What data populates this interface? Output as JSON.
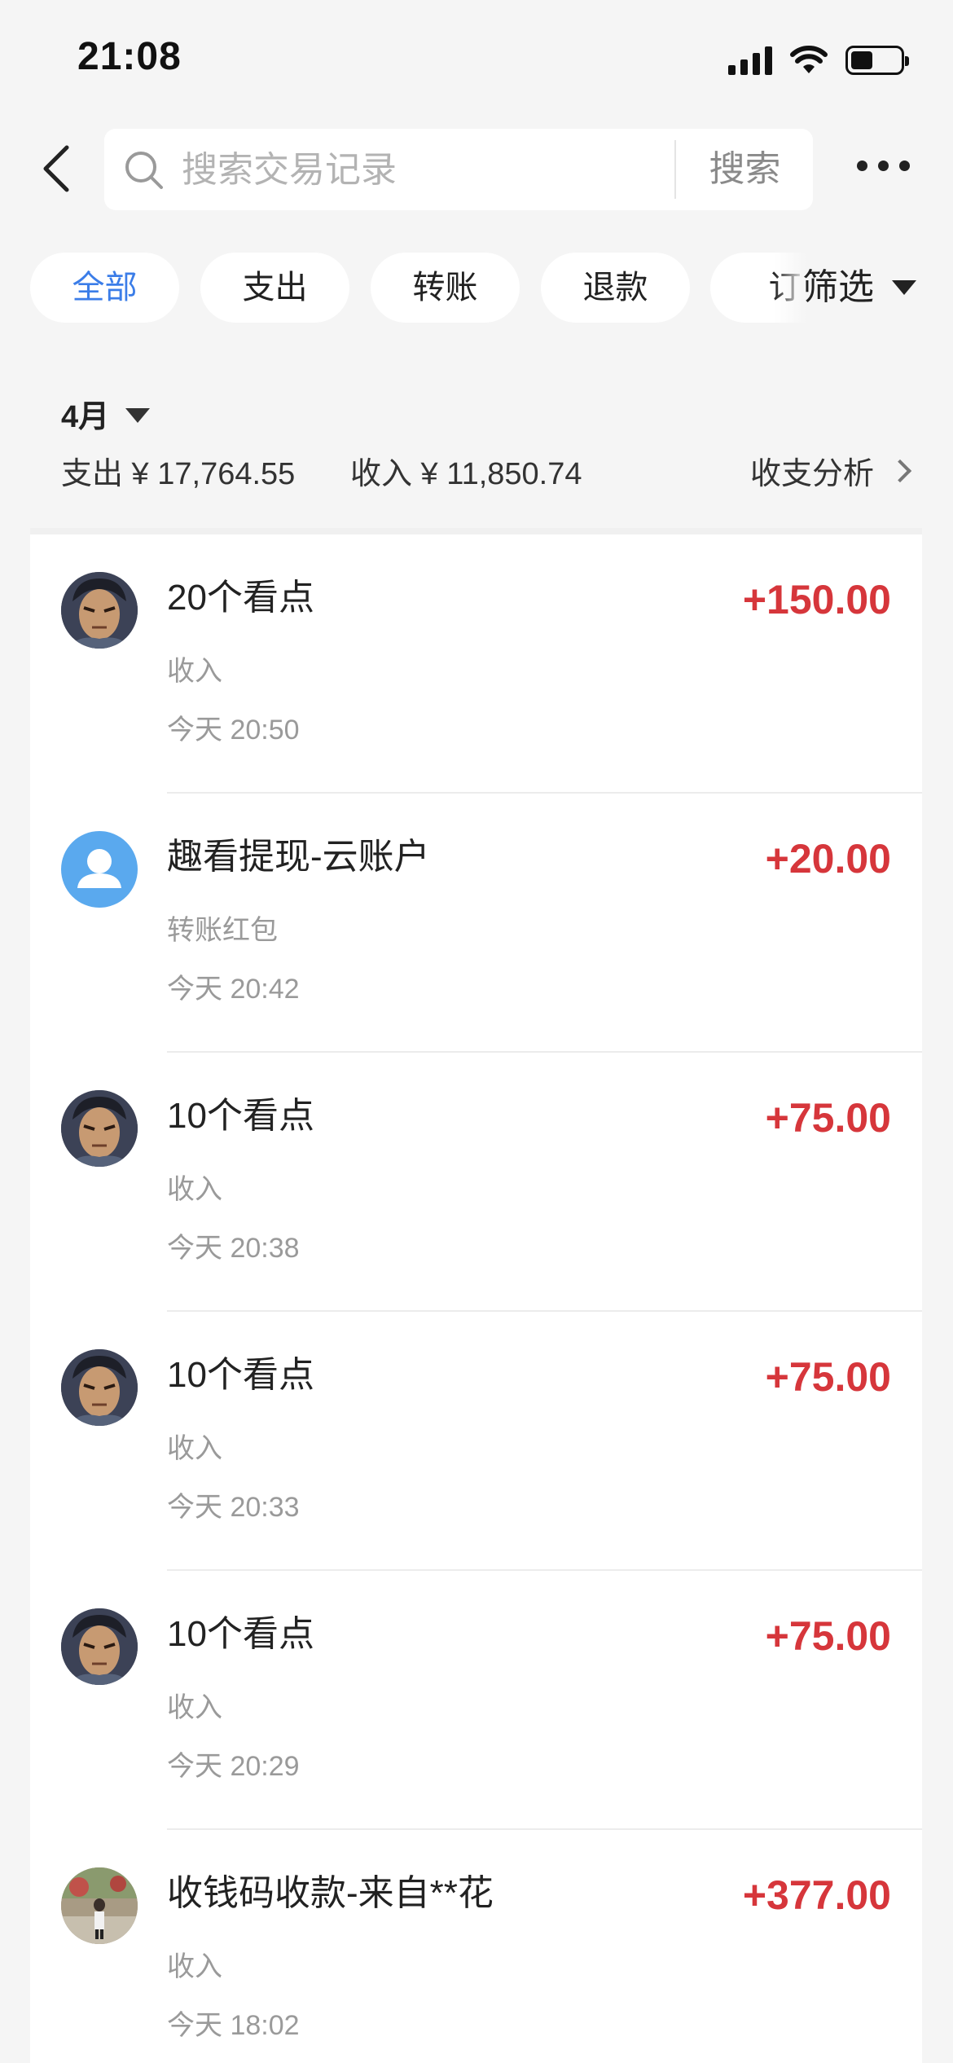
{
  "status_bar": {
    "time": "21:08"
  },
  "header": {
    "search_placeholder": "搜索交易记录",
    "search_button": "搜索"
  },
  "filters": {
    "chips": [
      "全部",
      "支出",
      "转账",
      "退款",
      "订"
    ],
    "active_index": 0,
    "filter_label": "筛选"
  },
  "summary": {
    "month": "4月",
    "expense": "支出 ¥ 17,764.55",
    "income": "收入 ¥ 11,850.74",
    "analysis_label": "收支分析"
  },
  "transactions": [
    {
      "title": "20个看点",
      "type": "收入",
      "time": "今天 20:50",
      "amount": "+150.00",
      "avatar": "anime-avatar"
    },
    {
      "title": "趣看提现-云账户",
      "type": "转账红包",
      "time": "今天 20:42",
      "amount": "+20.00",
      "avatar": "default-user-avatar"
    },
    {
      "title": "10个看点",
      "type": "收入",
      "time": "今天 20:38",
      "amount": "+75.00",
      "avatar": "anime-avatar"
    },
    {
      "title": "10个看点",
      "type": "收入",
      "time": "今天 20:33",
      "amount": "+75.00",
      "avatar": "anime-avatar"
    },
    {
      "title": "10个看点",
      "type": "收入",
      "time": "今天 20:29",
      "amount": "+75.00",
      "avatar": "anime-avatar"
    },
    {
      "title": "收钱码收款-来自**花",
      "type": "收入",
      "time": "今天 18:02",
      "amount": "+377.00",
      "avatar": "photo-avatar"
    }
  ],
  "colors": {
    "accent": "#3b7de8",
    "income_amount": "#d6363b",
    "background": "#f5f5f5"
  }
}
